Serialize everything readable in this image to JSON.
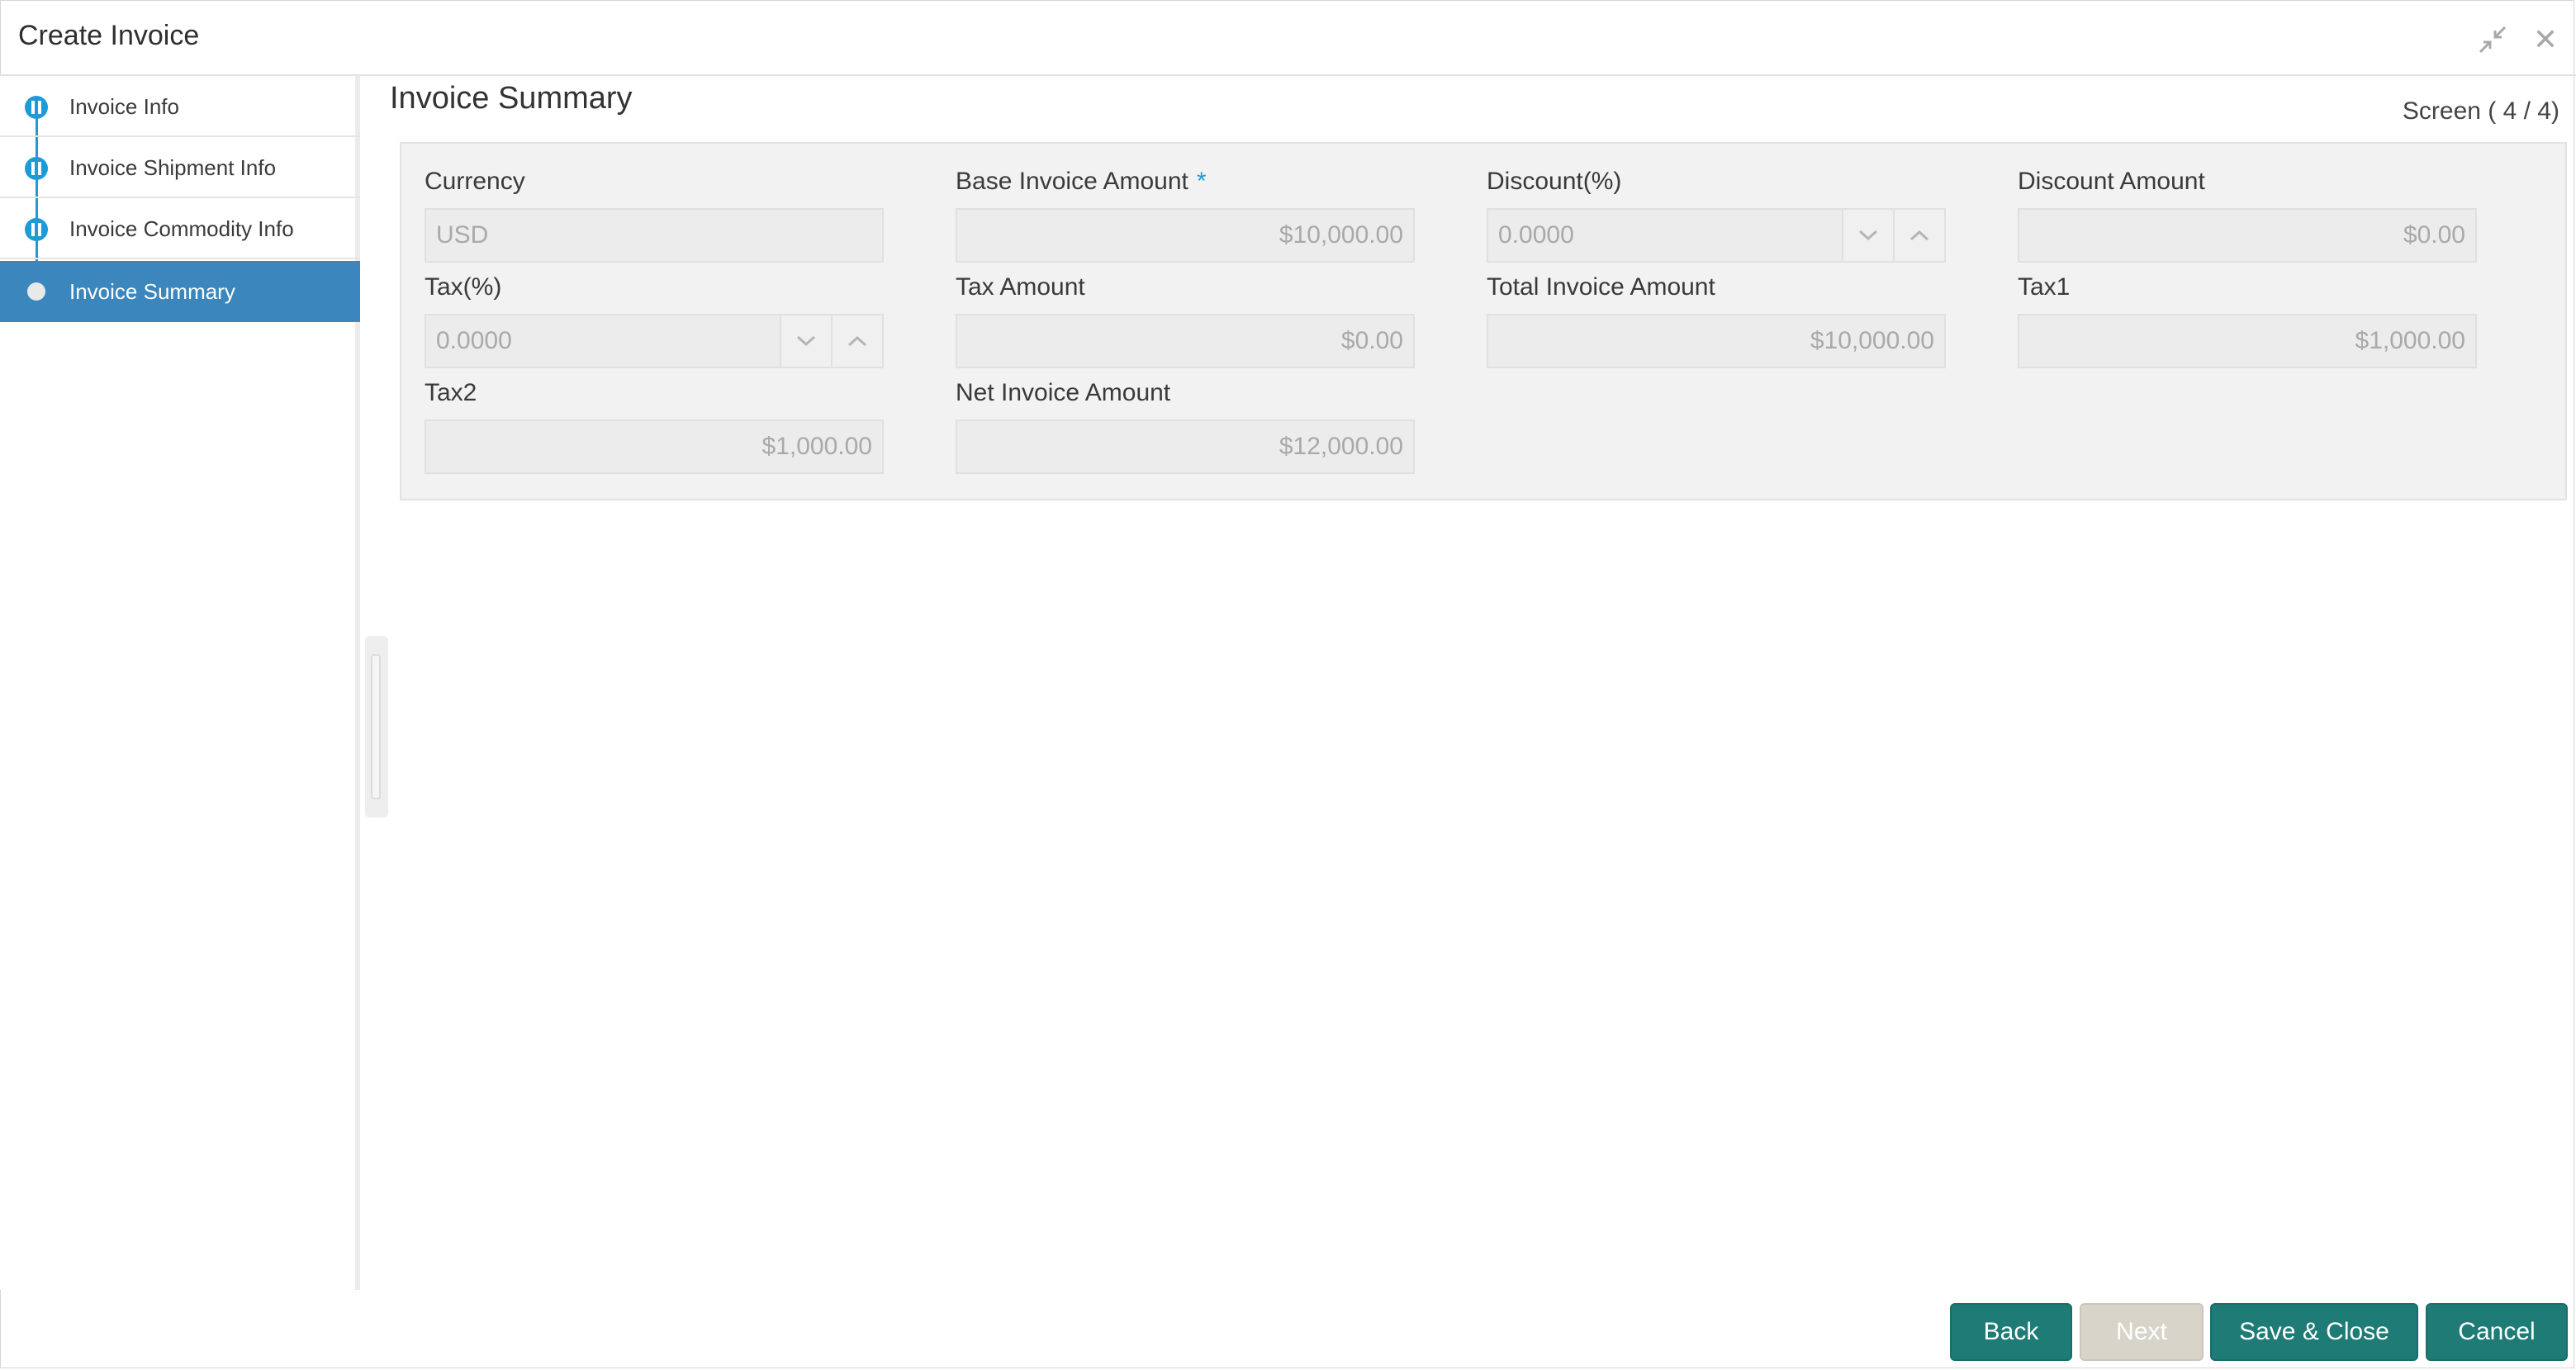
{
  "window": {
    "title": "Create Invoice",
    "minimize_icon": "collapse-arrows-icon",
    "close_icon": "close-icon",
    "close_glyph": "✕"
  },
  "sidebar": {
    "items": [
      {
        "label": "Invoice Info",
        "state": "complete"
      },
      {
        "label": "Invoice Shipment Info",
        "state": "complete"
      },
      {
        "label": "Invoice Commodity Info",
        "state": "complete"
      },
      {
        "label": "Invoice Summary",
        "state": "active"
      }
    ]
  },
  "main": {
    "section_title": "Invoice Summary",
    "screen_count": "Screen ( 4 / 4)",
    "fields": {
      "currency": {
        "label": "Currency",
        "value": "USD"
      },
      "base_invoice_amount": {
        "label": "Base Invoice Amount",
        "required_mark": "*",
        "value": "$10,000.00"
      },
      "discount_pct": {
        "label": "Discount(%)",
        "value": "0.0000"
      },
      "discount_amount": {
        "label": "Discount Amount",
        "value": "$0.00"
      },
      "tax_pct": {
        "label": "Tax(%)",
        "value": "0.0000"
      },
      "tax_amount": {
        "label": "Tax Amount",
        "value": "$0.00"
      },
      "total_invoice_amount": {
        "label": "Total Invoice Amount",
        "value": "$10,000.00"
      },
      "tax1": {
        "label": "Tax1",
        "value": "$1,000.00"
      },
      "tax2": {
        "label": "Tax2",
        "value": "$1,000.00"
      },
      "net_invoice_amount": {
        "label": "Net Invoice Amount",
        "value": "$12,000.00"
      }
    }
  },
  "footer": {
    "back_label": "Back",
    "next_label": "Next",
    "save_close_label": "Save & Close",
    "cancel_label": "Cancel"
  },
  "colors": {
    "accent": "#1d9bd8",
    "active_nav": "#3a86bd",
    "primary_button": "#1f7b76",
    "disabled_button": "#d9d4ca"
  }
}
